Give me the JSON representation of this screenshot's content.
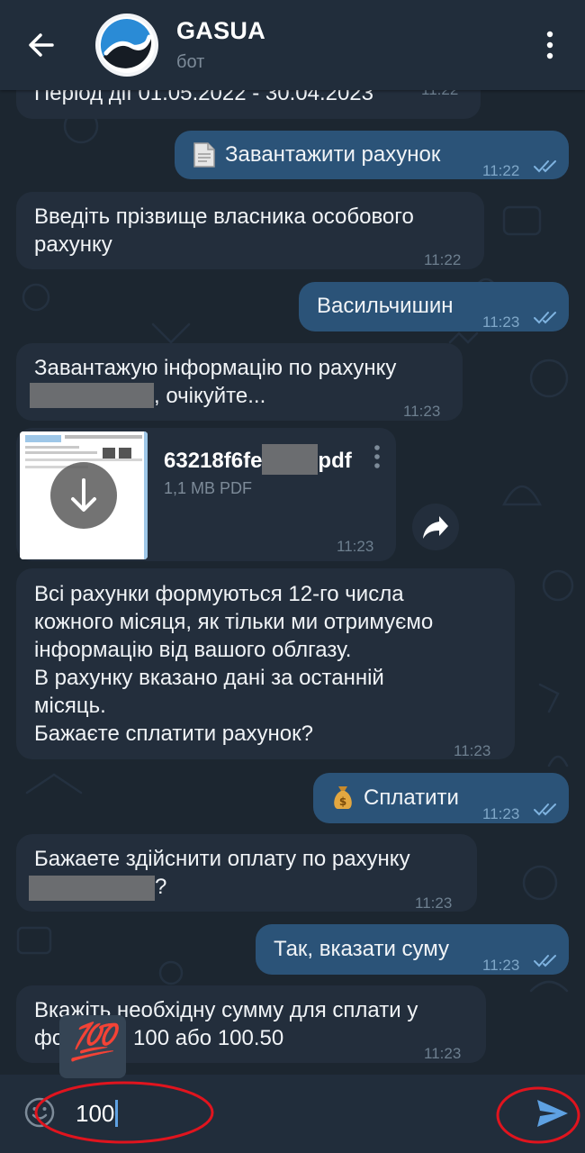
{
  "header": {
    "title": "GASUA",
    "subtitle": "бот"
  },
  "messages": [
    {
      "id": "m1",
      "side": "in",
      "text": "Період дії 01.05.2022 - 30.04.2023",
      "time": "11:22"
    },
    {
      "id": "m2",
      "side": "out",
      "icon": "document-icon",
      "text": "Завантажити рахунок",
      "time": "11:22",
      "status": "read"
    },
    {
      "id": "m3",
      "side": "in",
      "line1": "Введіть прізвище власника особового",
      "line2": "рахунку",
      "time": "11:22"
    },
    {
      "id": "m4",
      "side": "out",
      "text": "Васильчишин",
      "time": "11:23",
      "status": "read"
    },
    {
      "id": "m5",
      "side": "in",
      "line1": "Завантажую інформацію по рахунку",
      "line2_suffix": ", очікуйте...",
      "time": "11:23"
    },
    {
      "id": "m6",
      "side": "in",
      "type": "file",
      "filename_prefix": "63218f6fe",
      "filename_suffix": "pdf",
      "meta": "1,1 MB PDF",
      "time": "11:23"
    },
    {
      "id": "m7",
      "side": "in",
      "lines": [
        "Всі рахунки формуються 12-го числа",
        "кожного місяця, як тільки ми отримуємо",
        "інформацію від вашого облгазу.",
        "В рахунку вказано дані за останній",
        "місяць.",
        "Бажаєте сплатити рахунок?"
      ],
      "time": "11:23"
    },
    {
      "id": "m8",
      "side": "out",
      "icon": "money-bag-icon",
      "text": "Сплатити",
      "time": "11:23",
      "status": "read"
    },
    {
      "id": "m9",
      "side": "in",
      "line1": "Бажаете здійснити оплату по рахунку",
      "line2_suffix": "?",
      "time": "11:23"
    },
    {
      "id": "m10",
      "side": "out",
      "text": "Так, вказати суму",
      "time": "11:23",
      "status": "read"
    },
    {
      "id": "m11",
      "side": "in",
      "line1": "Вкажіть необхідну сумму для сплати у",
      "line2_prefix": "фо",
      "line2_suffix": "100 або 100.50",
      "time": "11:23"
    }
  ],
  "suggestion": {
    "emoji": "💯",
    "icon": "hundred-points-emoji"
  },
  "input": {
    "value": "100",
    "emoji_icon": "emoji-smile-icon",
    "send_icon": "send-icon"
  },
  "colors": {
    "background": "#1c2630",
    "header": "#212d3b",
    "incoming_bubble": "#232e3c",
    "outgoing_bubble": "#2b5378",
    "accent": "#5ea1e2",
    "annotation": "#e0141e"
  }
}
